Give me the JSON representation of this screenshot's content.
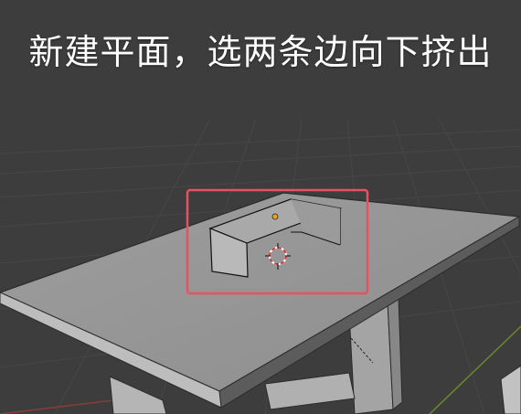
{
  "caption": "新建平面，选两条边向下挤出",
  "colors": {
    "background": "#3d3d3d",
    "grid": "#474747",
    "highlight_box": "#e8515f",
    "object_origin": "#f0a020",
    "x_axis": "#8a3b3b",
    "y_axis": "#6a8a2a"
  },
  "icons": {
    "cursor": "3d-cursor-icon",
    "origin": "object-origin-icon"
  }
}
